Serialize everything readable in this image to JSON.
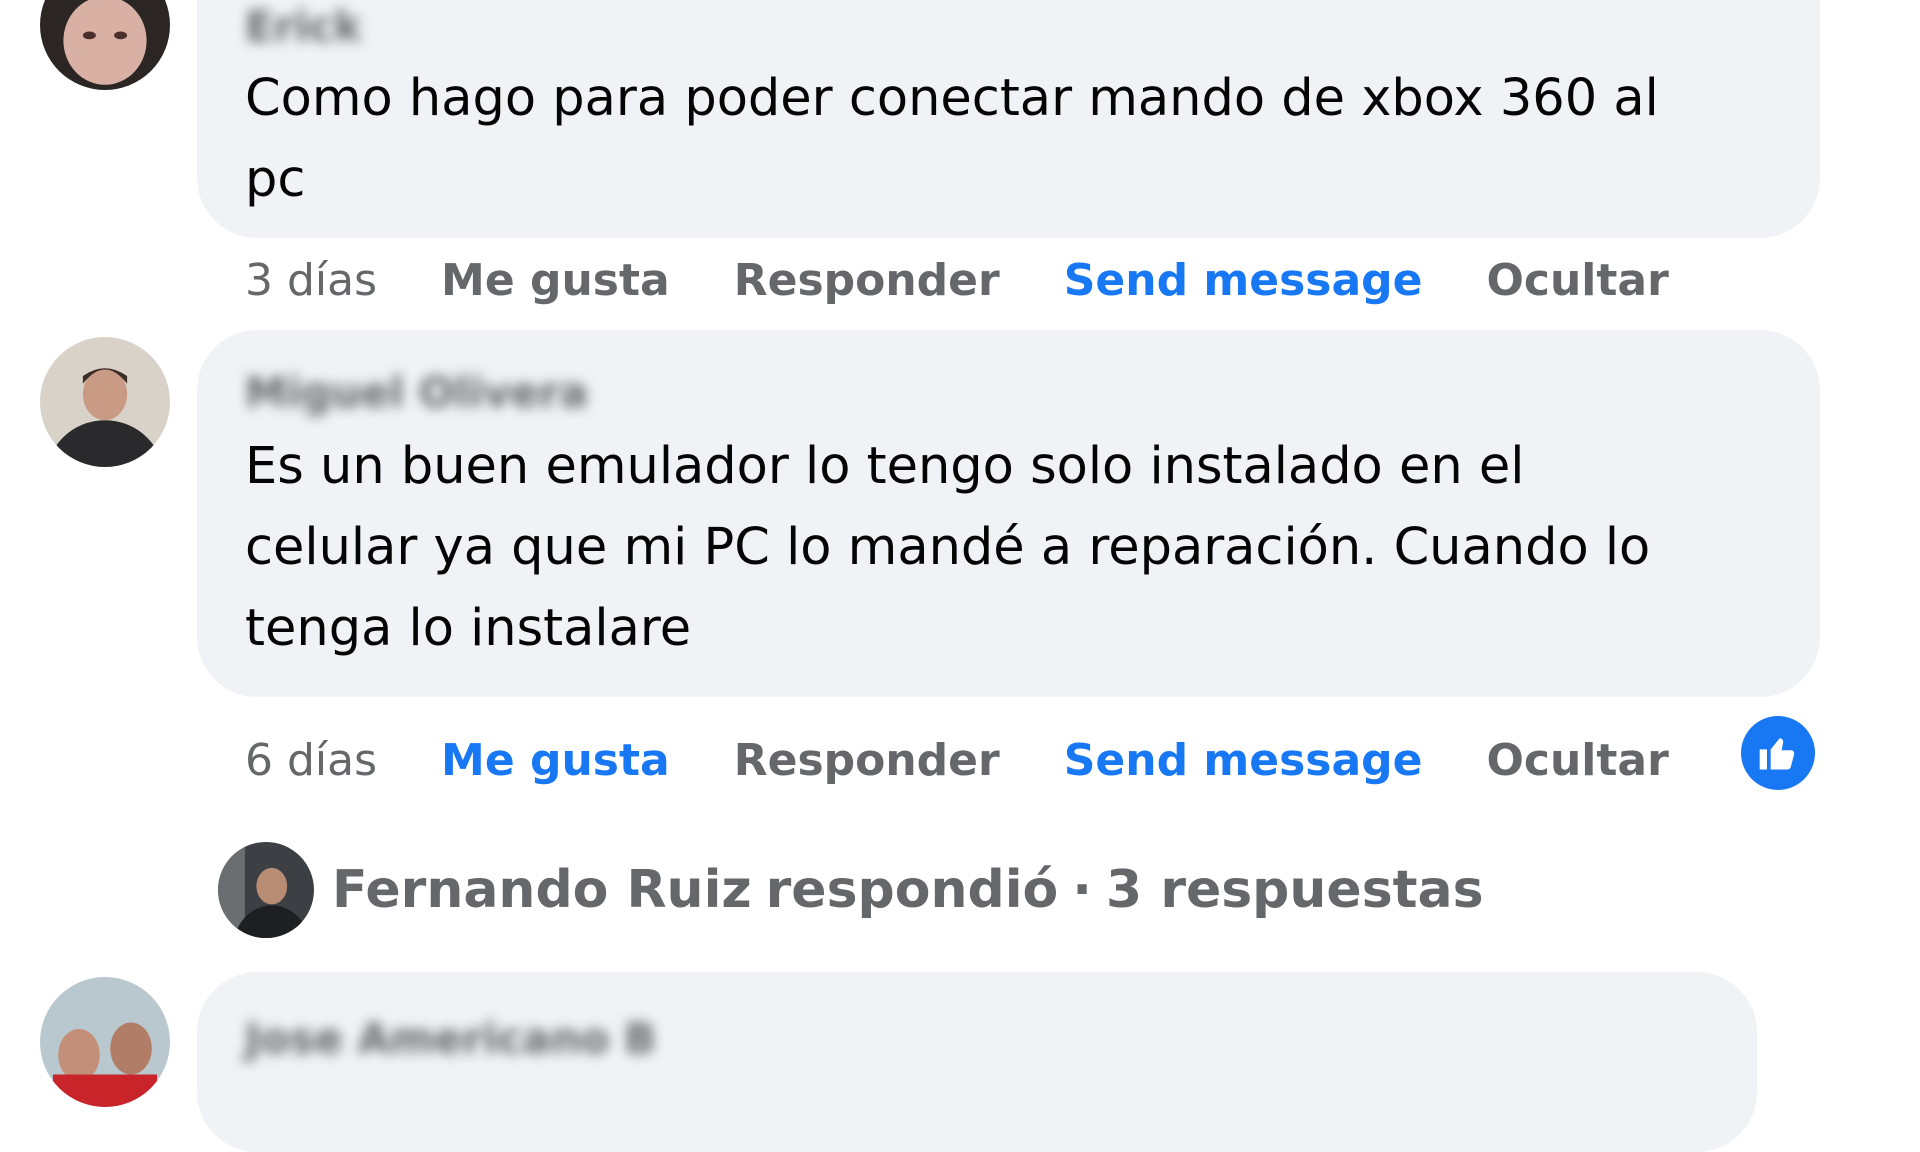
{
  "comments": [
    {
      "author": "Erick",
      "text_lines": [
        "Como hago para poder conectar mando de xbox 360 al",
        "pc"
      ],
      "time": "3 días",
      "like": "Me gusta",
      "reply": "Responder",
      "message": "Send message",
      "hide": "Ocultar",
      "liked": false
    },
    {
      "author": "Miguel Olivera",
      "text_lines": [
        "Es un buen emulador lo tengo solo instalado en el",
        "celular ya que mi PC lo mandé a reparación. Cuando lo",
        "tenga lo instalare"
      ],
      "time": "6 días",
      "like": "Me gusta",
      "reply": "Responder",
      "message": "Send message",
      "hide": "Ocultar",
      "liked": true,
      "reaction_icon": "thumbs-up-icon"
    },
    {
      "author": "Jose Americano B",
      "text_lines": []
    }
  ],
  "replies_summary": {
    "name": "Fernando Ruiz",
    "verb": "respondió",
    "separator": "·",
    "count": "3 respuestas"
  },
  "colors": {
    "bubble": "#f0f2f5",
    "accent": "#1877f2",
    "muted": "#65676b",
    "text": "#050505"
  }
}
